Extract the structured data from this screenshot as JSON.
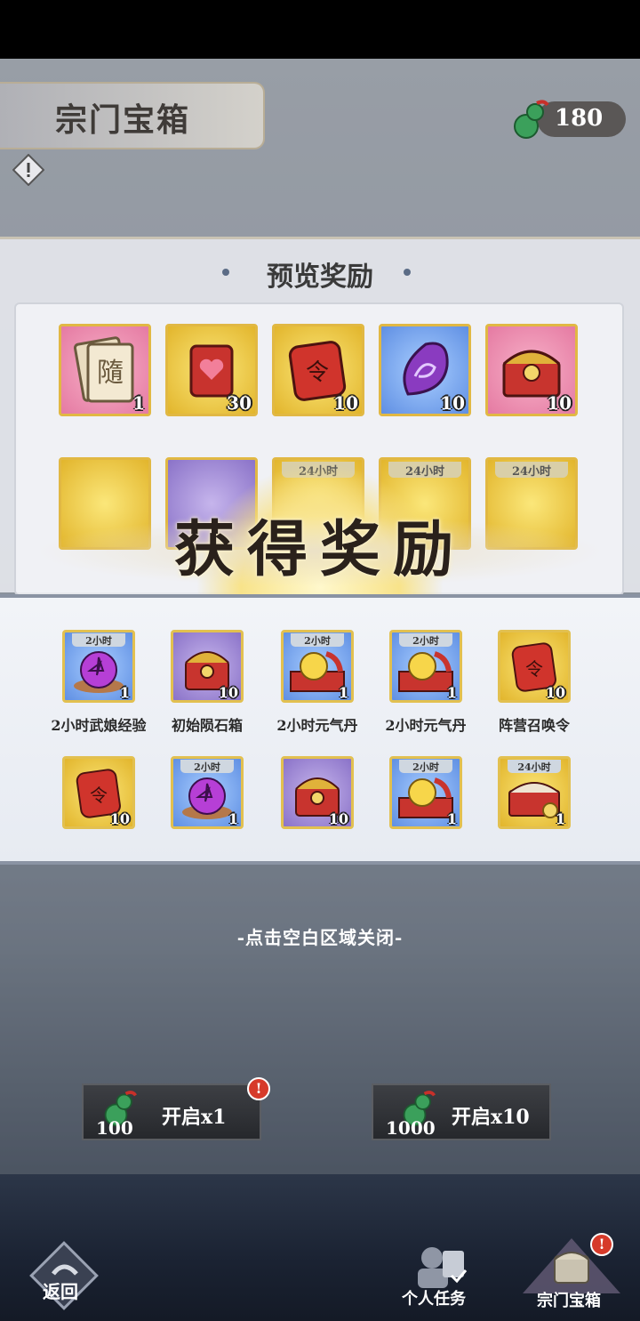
{
  "header": {
    "title": "宗门宝箱",
    "currency_value": "180",
    "currency_icon": "jade-gourd-icon"
  },
  "preview": {
    "title": "预览奖励",
    "row1": [
      {
        "icon": "card-pack-icon",
        "count": "1",
        "rarity": "pink"
      },
      {
        "icon": "heart-pouch-icon",
        "count": "30",
        "rarity": "gold"
      },
      {
        "icon": "summon-token-icon",
        "count": "10",
        "rarity": "gold"
      },
      {
        "icon": "purple-stone-icon",
        "count": "10",
        "rarity": "blue"
      },
      {
        "icon": "treasure-chest-icon",
        "count": "10",
        "rarity": "pink"
      }
    ],
    "row2_tags": [
      "24小时",
      "24小时",
      "24小时"
    ]
  },
  "banner": {
    "text": "获得奖励"
  },
  "obtained": {
    "row1": [
      {
        "tag": "2小时",
        "icon": "pentagram-orb-icon",
        "count": "1",
        "label": "2小时武娘经验",
        "rarity": "blue"
      },
      {
        "tag": "",
        "icon": "meteor-chest-icon",
        "count": "10",
        "label": "初始陨石箱",
        "rarity": "purple"
      },
      {
        "tag": "2小时",
        "icon": "golden-pill-box-icon",
        "count": "1",
        "label": "2小时元气丹",
        "rarity": "blue"
      },
      {
        "tag": "2小时",
        "icon": "golden-pill-box-icon",
        "count": "1",
        "label": "2小时元气丹",
        "rarity": "blue"
      },
      {
        "tag": "",
        "icon": "summon-token-icon",
        "count": "10",
        "label": "阵营召唤令",
        "rarity": "gold"
      }
    ],
    "row2": [
      {
        "tag": "",
        "icon": "summon-token-icon",
        "count": "10",
        "rarity": "gold"
      },
      {
        "tag": "2小时",
        "icon": "pentagram-orb-icon",
        "count": "1",
        "rarity": "blue"
      },
      {
        "tag": "",
        "icon": "meteor-chest-icon",
        "count": "10",
        "rarity": "purple"
      },
      {
        "tag": "2小时",
        "icon": "golden-pill-box-icon",
        "count": "1",
        "rarity": "blue"
      },
      {
        "tag": "24小时",
        "icon": "coin-chest-icon",
        "count": "1",
        "rarity": "gold"
      }
    ]
  },
  "close_hint": "-点击空白区域关闭-",
  "buttons": {
    "open1": {
      "label": "开启x1",
      "cost": "100",
      "badge": "!"
    },
    "open10": {
      "label": "开启x10",
      "cost": "1000"
    }
  },
  "nav": {
    "back": "返回",
    "tasks": "个人任务",
    "chest": "宗门宝箱",
    "chest_badge": "!"
  }
}
